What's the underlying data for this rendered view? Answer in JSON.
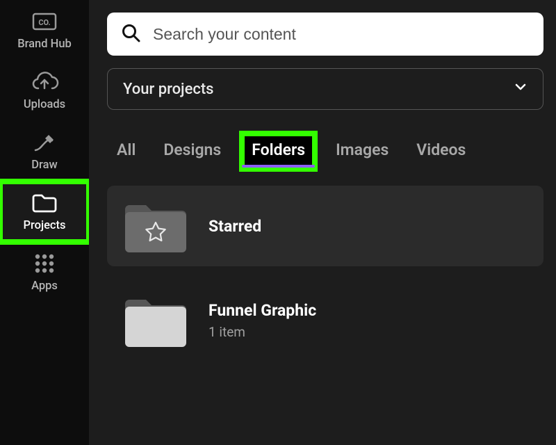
{
  "sidebar": {
    "items": [
      {
        "label": "Brand Hub",
        "icon": "brand-hub"
      },
      {
        "label": "Uploads",
        "icon": "cloud-upload"
      },
      {
        "label": "Draw",
        "icon": "draw"
      },
      {
        "label": "Projects",
        "icon": "folder",
        "active": true,
        "highlighted": true
      },
      {
        "label": "Apps",
        "icon": "apps-grid"
      }
    ]
  },
  "search": {
    "placeholder": "Search your content"
  },
  "dropdown": {
    "label": "Your projects"
  },
  "tabs": [
    {
      "label": "All"
    },
    {
      "label": "Designs"
    },
    {
      "label": "Folders",
      "active": true,
      "highlighted": true
    },
    {
      "label": "Images"
    },
    {
      "label": "Videos"
    }
  ],
  "folders": [
    {
      "name": "Starred",
      "meta": "",
      "icon": "star",
      "row_highlight": true
    },
    {
      "name": "Funnel Graphic",
      "meta": "1 item",
      "icon": "blank"
    }
  ],
  "colors": {
    "highlight": "#33ff00",
    "underline": "#8b5cf6"
  }
}
